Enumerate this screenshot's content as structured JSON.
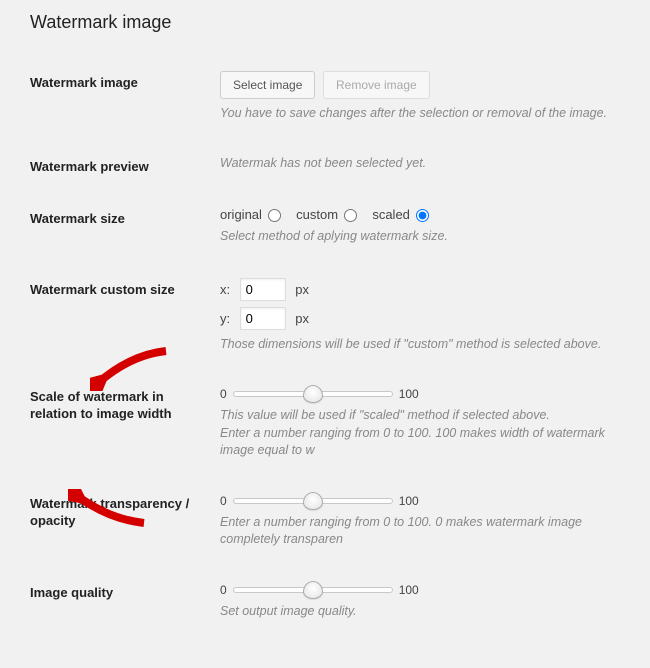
{
  "section_title": "Watermark image",
  "rows": {
    "watermark_image": {
      "label": "Watermark image",
      "select_btn": "Select image",
      "remove_btn": "Remove image",
      "desc": "You have to save changes after the selection or removal of the image."
    },
    "preview": {
      "label": "Watermark preview",
      "desc": "Watermak has not been selected yet."
    },
    "size": {
      "label": "Watermark size",
      "opt_original": "original",
      "opt_custom": "custom",
      "opt_scaled": "scaled",
      "desc": "Select method of aplying watermark size."
    },
    "custom_size": {
      "label": "Watermark custom size",
      "x_label": "x:",
      "y_label": "y:",
      "x_value": "0",
      "y_value": "0",
      "unit": "px",
      "desc": "Those dimensions will be used if \"custom\" method is selected above."
    },
    "scale": {
      "label": "Scale of watermark in relation to image width",
      "min": "0",
      "max": "100",
      "value_percent": 50,
      "desc1": "This value will be used if \"scaled\" method if selected above.",
      "desc2": "Enter a number ranging from 0 to 100. 100 makes width of watermark image equal to w"
    },
    "transparency": {
      "label": "Watermark transparency / opacity",
      "min": "0",
      "max": "100",
      "value_percent": 50,
      "desc": "Enter a number ranging from 0 to 100. 0 makes watermark image completely transparen"
    },
    "quality": {
      "label": "Image quality",
      "min": "0",
      "max": "100",
      "value_percent": 50,
      "desc": "Set output image quality."
    }
  }
}
